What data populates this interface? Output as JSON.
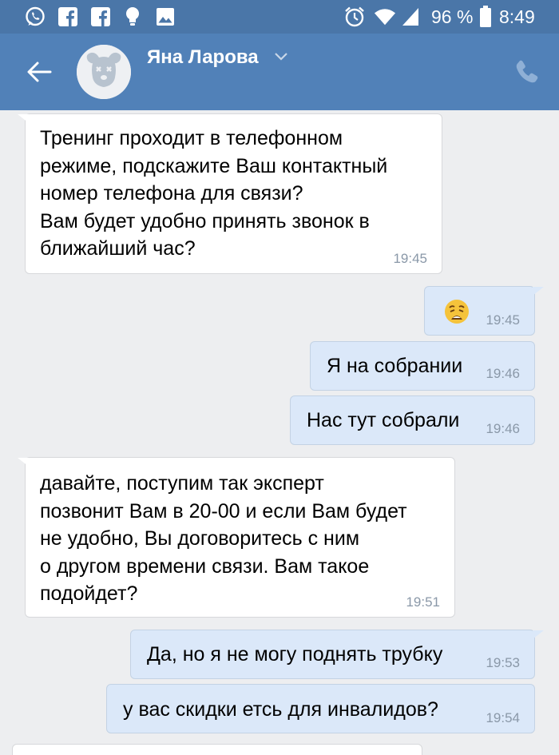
{
  "status_bar": {
    "battery": "96 %",
    "time": "8:49",
    "icons": [
      "whatsapp-icon",
      "facebook-icon",
      "facebook-icon",
      "bulb-icon",
      "image-icon",
      "alarm-icon",
      "wifi-icon",
      "signal-icon",
      "battery-icon"
    ]
  },
  "header": {
    "contact_name": "Яна Ларова",
    "icons": [
      "back-arrow-icon",
      "avatar-dog-icon",
      "chevron-down-icon",
      "phone-icon"
    ]
  },
  "messages": [
    {
      "direction": "in",
      "lines": [
        "Тренинг проходит в телефонном",
        "режиме, подскажите Ваш контактный",
        "номер телефона для связи?",
        "Вам будет удобно принять звонок в",
        "ближайший час?"
      ],
      "time": "19:45"
    },
    {
      "direction": "out",
      "emoji": "weary-face-emoji",
      "time": "19:45"
    },
    {
      "direction": "out",
      "lines": [
        "Я на собрании"
      ],
      "time": "19:46"
    },
    {
      "direction": "out",
      "lines": [
        "Нас тут собрали"
      ],
      "time": "19:46"
    },
    {
      "direction": "in",
      "lines": [
        "давайте, поступим так эксперт",
        "позвонит Вам в 20-00 и если Вам будет",
        "не удобно, Вы договоритесь с ним",
        "о другом времени связи. Вам такое",
        "подойдет?"
      ],
      "time": "19:51"
    },
    {
      "direction": "out",
      "lines": [
        "Да, но я не могу поднять трубку"
      ],
      "time": "19:53"
    },
    {
      "direction": "out",
      "lines": [
        "у вас скидки етсь для инвалидов?"
      ],
      "time": "19:54"
    }
  ],
  "colors": {
    "status_bar": "#4a76a8",
    "header": "#5181b8",
    "background": "#edeef0",
    "incoming_bubble": "#ffffff",
    "outgoing_bubble": "#dbe8f9",
    "time_text": "#8a98a8"
  }
}
